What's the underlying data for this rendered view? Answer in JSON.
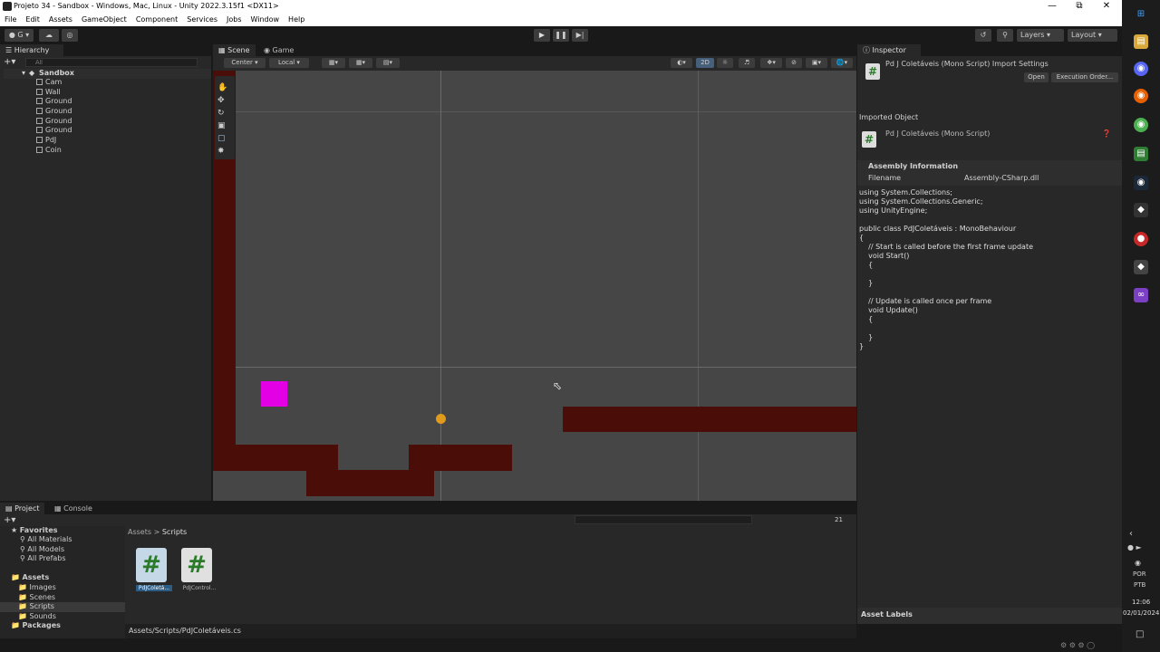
{
  "window": {
    "title": "Projeto 34 - Sandbox - Windows, Mac, Linux - Unity 2022.3.15f1 <DX11>"
  },
  "menu": [
    "File",
    "Edit",
    "Assets",
    "GameObject",
    "Component",
    "Services",
    "Jobs",
    "Window",
    "Help"
  ],
  "toolbar": {
    "account": "G",
    "layers": "Layers",
    "layout": "Layout"
  },
  "hierarchy": {
    "tab": "Hierarchy",
    "search_placeholder": "All",
    "scene": "Sandbox",
    "items": [
      "Cam",
      "Wall",
      "Ground",
      "Ground",
      "Ground",
      "Ground",
      "PdJ",
      "Coin"
    ]
  },
  "scene": {
    "tabs": [
      "Scene",
      "Game"
    ],
    "pivot": "Center",
    "space": "Local",
    "mode_2d": "2D"
  },
  "inspector": {
    "tab": "Inspector",
    "header": "Pd J Coletáveis (Mono Script) Import Settings",
    "open": "Open",
    "exec_order": "Execution Order...",
    "imported_object_label": "Imported Object",
    "object_name": "Pd J Coletáveis (Mono Script)",
    "assembly_header": "Assembly Information",
    "filename_label": "Filename",
    "filename_value": "Assembly-CSharp.dll",
    "code": "using System.Collections;\nusing System.Collections.Generic;\nusing UnityEngine;\n\npublic class PdJColetáveis : MonoBehaviour\n{\n    // Start is called before the first frame update\n    void Start()\n    {\n\n    }\n\n    // Update is called once per frame\n    void Update()\n    {\n\n    }\n}",
    "asset_labels": "Asset Labels"
  },
  "project": {
    "tabs": [
      "Project",
      "Console"
    ],
    "favorites_label": "Favorites",
    "favorites": [
      "All Materials",
      "All Models",
      "All Prefabs"
    ],
    "assets_label": "Assets",
    "folders": [
      "Images",
      "Scenes",
      "Scripts",
      "Sounds"
    ],
    "packages_label": "Packages",
    "breadcrumb": [
      "Assets",
      "Scripts"
    ],
    "files": [
      "PdJColetá...",
      "PdJControl..."
    ],
    "count": "21",
    "path": "Assets/Scripts/PdJColetáveis.cs"
  },
  "taskbar": {
    "lang1": "POR",
    "lang2": "PTB",
    "time": "12:06",
    "date": "02/01/2024"
  },
  "colors": {
    "brick": "#4a0d07",
    "player": "#e400e4",
    "coin": "#e19b1c",
    "viewport": "#464646"
  }
}
